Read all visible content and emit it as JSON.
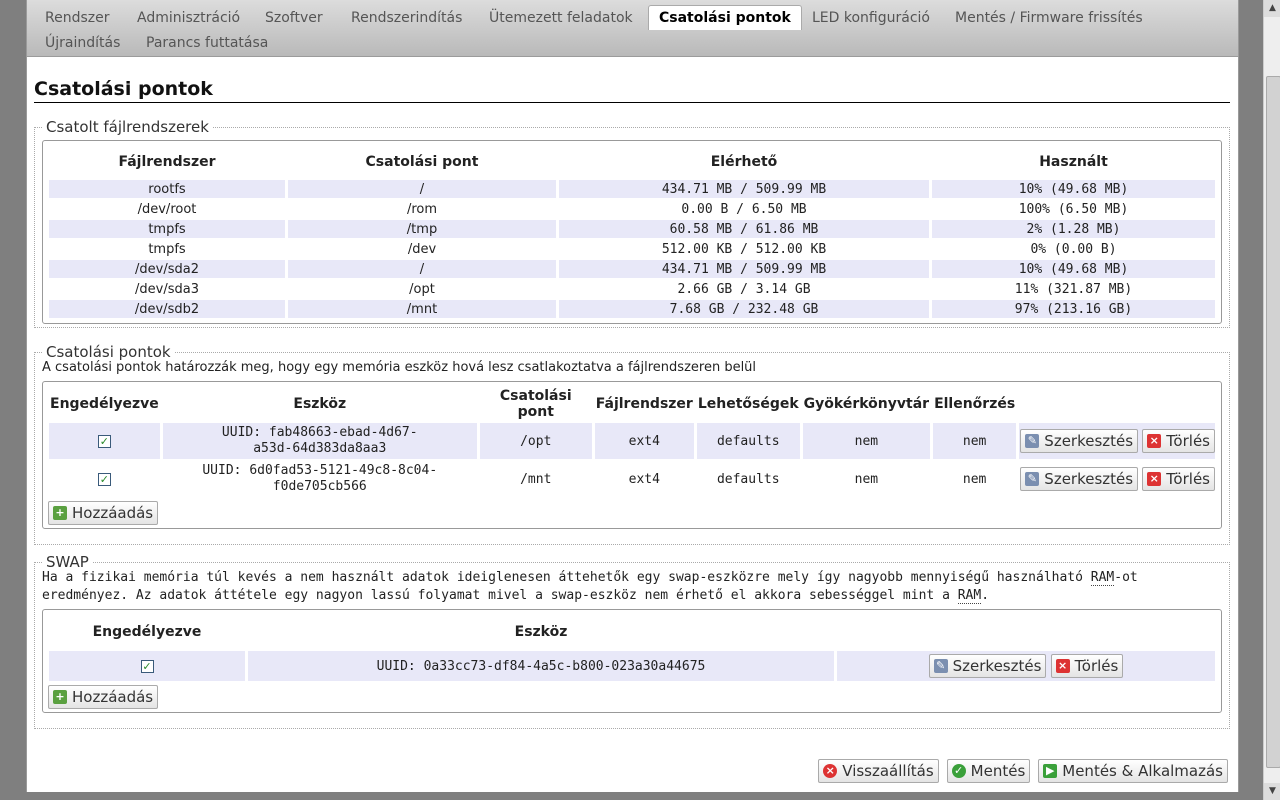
{
  "tabs": [
    {
      "label": "Rendszer"
    },
    {
      "label": "Adminisztráció"
    },
    {
      "label": "Szoftver"
    },
    {
      "label": "Rendszerindítás"
    },
    {
      "label": "Ütemezett feladatok"
    },
    {
      "label": "Csatolási pontok"
    },
    {
      "label": "LED konfiguráció"
    },
    {
      "label": "Mentés / Firmware frissítés"
    },
    {
      "label": "Újraindítás"
    },
    {
      "label": "Parancs futtatása"
    }
  ],
  "page_title": "Csatolási pontok",
  "mounted": {
    "legend": "Csatolt fájlrendszerek",
    "headers": {
      "fs": "Fájlrendszer",
      "mount": "Csatolási pont",
      "avail": "Elérhető",
      "used": "Használt"
    },
    "rows": [
      {
        "fs": "rootfs",
        "mount": "/",
        "avail": "434.71 MB / 509.99 MB",
        "used": "10% (49.68 MB)"
      },
      {
        "fs": "/dev/root",
        "mount": "/rom",
        "avail": "0.00 B / 6.50 MB",
        "used": "100% (6.50 MB)"
      },
      {
        "fs": "tmpfs",
        "mount": "/tmp",
        "avail": "60.58 MB / 61.86 MB",
        "used": "2% (1.28 MB)"
      },
      {
        "fs": "tmpfs",
        "mount": "/dev",
        "avail": "512.00 KB / 512.00 KB",
        "used": "0% (0.00 B)"
      },
      {
        "fs": "/dev/sda2",
        "mount": "/",
        "avail": "434.71 MB / 509.99 MB",
        "used": "10% (49.68 MB)"
      },
      {
        "fs": "/dev/sda3",
        "mount": "/opt",
        "avail": "2.66 GB / 3.14 GB",
        "used": "11% (321.87 MB)"
      },
      {
        "fs": "/dev/sdb2",
        "mount": "/mnt",
        "avail": "7.68 GB / 232.48 GB",
        "used": "97% (213.16 GB)"
      }
    ]
  },
  "mountpoints": {
    "legend": "Csatolási pontok",
    "description": "A csatolási pontok határozzák meg, hogy egy memória eszköz hová lesz csatlakoztatva a fájlrendszeren belül",
    "headers": {
      "enabled": "Engedélyezve",
      "device": "Eszköz",
      "mount": "Csatolási pont",
      "fs": "Fájlrendszer",
      "options": "Lehetőségek",
      "root": "Gyökérkönyvtár",
      "check": "Ellenőrzés"
    },
    "rows": [
      {
        "enabled": "✓",
        "device_line1": "UUID: fab48663-ebad-4d67-",
        "device_line2": "a53d-64d383da8aa3",
        "mount": "/opt",
        "fs": "ext4",
        "options": "defaults",
        "root": "nem",
        "check": "nem"
      },
      {
        "enabled": "✓",
        "device_line1": "UUID: 6d0fad53-5121-49c8-8c04-",
        "device_line2": "f0de705cb566",
        "mount": "/mnt",
        "fs": "ext4",
        "options": "defaults",
        "root": "nem",
        "check": "nem"
      }
    ]
  },
  "swap": {
    "legend": "SWAP",
    "desc_part1": "Ha a fizikai memória túl kevés a nem használt adatok ideiglenesen áttehetők egy swap-eszközre mely így nagyobb mennyiségű használható ",
    "desc_abbr1": "RAM",
    "desc_part2": "-ot eredményez. Az adatok áttétele egy nagyon lassú folyamat mivel a swap-eszköz nem érhető el akkora sebességgel mint a ",
    "desc_abbr2": "RAM",
    "desc_part3": ".",
    "headers": {
      "enabled": "Engedélyezve",
      "device": "Eszköz"
    },
    "rows": [
      {
        "enabled": "✓",
        "device": "UUID: 0a33cc73-df84-4a5c-b800-023a30a44675"
      }
    ]
  },
  "buttons": {
    "edit": "Szerkesztés",
    "delete": "Törlés",
    "add": "Hozzáadás",
    "reset": "Visszaállítás",
    "save": "Mentés",
    "save_apply": "Mentés & Alkalmazás"
  },
  "icons": {
    "edit": "edit-icon",
    "delete": "delete-icon",
    "add": "add-icon",
    "reset": "reset-icon",
    "save": "save-icon",
    "apply": "apply-icon"
  }
}
